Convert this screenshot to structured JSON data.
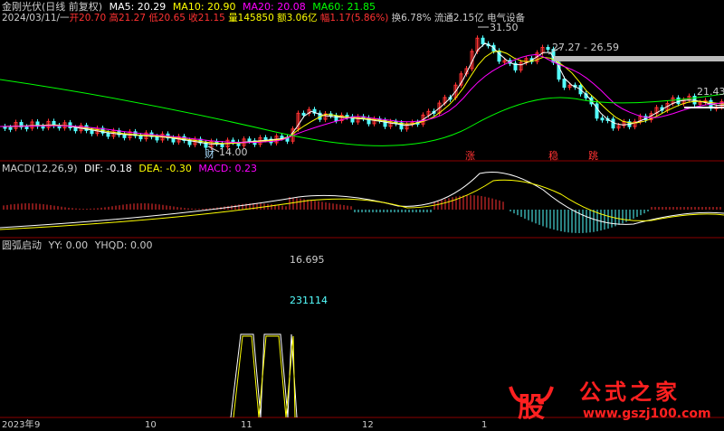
{
  "stock": {
    "title": "金刚光伏(日线 前复权)",
    "date_line": "2024/03/11/一",
    "ma5_label": "MA5: 20.29",
    "ma10_label": "MA10: 20.90",
    "ma20_label": "MA20: 20.08",
    "ma60_label": "MA60: 21.85",
    "open_label": "开20.70",
    "high_label": "高21.27",
    "low_label": "低20.65",
    "close_label": "收21.15",
    "volume_label": "量145850",
    "amount_label": "额3.06亿",
    "change_label": "幅1.17(5.86%)",
    "turnover_label": "换6.78%",
    "float_label": "流通2.15亿",
    "sector_label": "电气设备"
  },
  "price_panel": {
    "high_annot": "31.50",
    "low_annot": "14.00",
    "right_annot": "21.43",
    "range_annot": "27.27 - 26.59",
    "marker_cai": "财",
    "marker_zhang": "涨",
    "marker_wen": "稳",
    "marker_tiao": "跳"
  },
  "macd_panel": {
    "title": "MACD(12,26,9)",
    "dif_label": "DIF: -0.18",
    "dea_label": "DEA: -0.30",
    "macd_label": "MACD: 0.23"
  },
  "signal_panel": {
    "title": "圆弧启动",
    "yy_label": "YY: 0.00",
    "yhqd_label": "YHQD: 0.00",
    "value1": "16.695",
    "value2": "231114"
  },
  "time_axis": {
    "labels": [
      "2023年",
      "9",
      "10",
      "11",
      "12",
      "1"
    ]
  },
  "watermark": {
    "logo_char": "股",
    "site_name": "公式之家",
    "url": "www.gszj100.com"
  },
  "colors": {
    "up": "#ff3232",
    "down": "#54ffff",
    "ma5": "#ffffff",
    "ma10": "#ffff00",
    "ma20": "#ff00ff",
    "ma60": "#00ff00",
    "grid": "#8b0000"
  }
}
